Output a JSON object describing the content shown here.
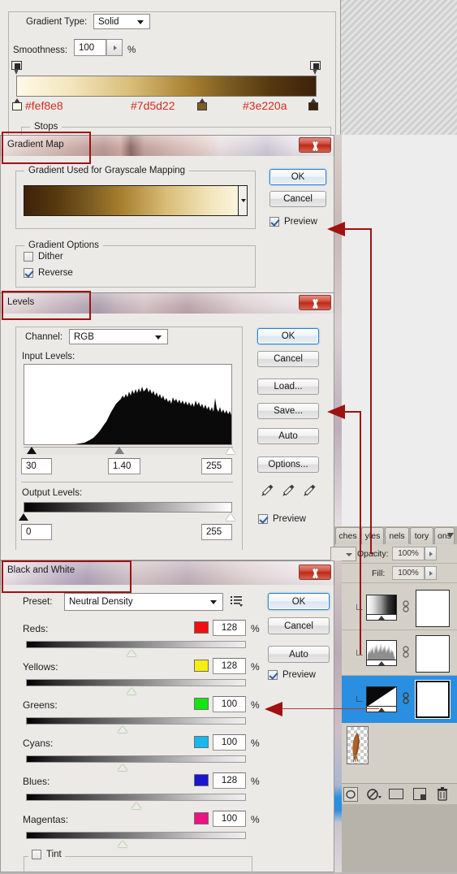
{
  "gradient_editor": {
    "gradient_type_label": "Gradient Type:",
    "gradient_type_value": "Solid",
    "smoothness_label": "Smoothness:",
    "smoothness_value": "100",
    "percent": "%",
    "stops_label": "Stops",
    "ramp_css": "linear-gradient(to right,#fef8e8 0%,#f3e6bd 18%,#d9bd78 38%,#a8802f 58%,#7d5d22 70%,#56380f 85%,#3e220a 100%)",
    "color_stops": [
      {
        "hex": "#fef8e8",
        "label": "#fef8e8",
        "position_pct": 0
      },
      {
        "hex": "#7d5d22",
        "label": "#7d5d22",
        "position_pct": 66
      },
      {
        "hex": "#3e220a",
        "label": "#3e220a",
        "position_pct": 100
      }
    ]
  },
  "gradient_map": {
    "title": "Gradient Map",
    "group_label": "Gradient Used for Grayscale Mapping",
    "preview_gradient_css": "linear-gradient(to right,#3e220a 0%,#56380f 14%,#7d5d22 30%,#a8802f 44%,#d9bd78 64%,#f3e6bd 84%,#fef8e8 100%)",
    "options_label": "Gradient Options",
    "dither_label": "Dither",
    "dither_checked": false,
    "reverse_label": "Reverse",
    "reverse_checked": true,
    "ok_label": "OK",
    "cancel_label": "Cancel",
    "preview_label": "Preview",
    "preview_checked": true
  },
  "levels": {
    "title": "Levels",
    "channel_label": "Channel:",
    "channel_value": "RGB",
    "input_levels_label": "Input Levels:",
    "input_shadow": "30",
    "input_gamma": "1.40",
    "input_highlight": "255",
    "output_levels_label": "Output Levels:",
    "output_black": "0",
    "output_white": "255",
    "ok_label": "OK",
    "cancel_label": "Cancel",
    "load_label": "Load...",
    "save_label": "Save...",
    "auto_label": "Auto",
    "options_label": "Options...",
    "preview_label": "Preview",
    "preview_checked": true
  },
  "black_and_white": {
    "title": "Black and White",
    "preset_label": "Preset:",
    "preset_value": "Neutral Density",
    "ok_label": "OK",
    "cancel_label": "Cancel",
    "auto_label": "Auto",
    "preview_label": "Preview",
    "preview_checked": true,
    "tint_label": "Tint",
    "tint_checked": false,
    "percent": "%",
    "channels": [
      {
        "label": "Reds:",
        "value": "128",
        "swatch": "#ee1111",
        "knob_pct": 48
      },
      {
        "label": "Yellows:",
        "value": "128",
        "swatch": "#f6ee10",
        "knob_pct": 48
      },
      {
        "label": "Greens:",
        "value": "100",
        "swatch": "#12e512",
        "knob_pct": 44
      },
      {
        "label": "Cyans:",
        "value": "100",
        "swatch": "#17b7ef",
        "knob_pct": 44
      },
      {
        "label": "Blues:",
        "value": "128",
        "swatch": "#1a15cf",
        "knob_pct": 50
      },
      {
        "label": "Magentas:",
        "value": "100",
        "swatch": "#ec1383",
        "knob_pct": 44
      }
    ]
  },
  "layers_panel": {
    "tabs": [
      "ches",
      "yles",
      "nels",
      "tory",
      "ons"
    ],
    "opacity_label": "Opacity:",
    "opacity_value": "100%",
    "fill_label": "Fill:",
    "fill_value": "100%",
    "layers": [
      {
        "type": "gradient-map-adjustment",
        "clipped": true,
        "selected": false,
        "mask": "white"
      },
      {
        "type": "levels-adjustment",
        "clipped": true,
        "selected": false,
        "mask": "white"
      },
      {
        "type": "black-white-adjustment",
        "clipped": true,
        "selected": true,
        "mask": "white"
      },
      {
        "type": "image-layer",
        "clipped": false,
        "selected": false,
        "mask": "none"
      }
    ],
    "bottom_buttons": [
      "link-layers",
      "layer-style",
      "layer-mask",
      "new-layer",
      "delete-layer"
    ]
  },
  "annotations": {
    "boxes": [
      "Gradient Map",
      "Levels",
      "Black and White"
    ],
    "arrow_targets": [
      "gradient-map-preview",
      "levels-save",
      "black-and-white-greens"
    ],
    "color": "#9e1212"
  }
}
